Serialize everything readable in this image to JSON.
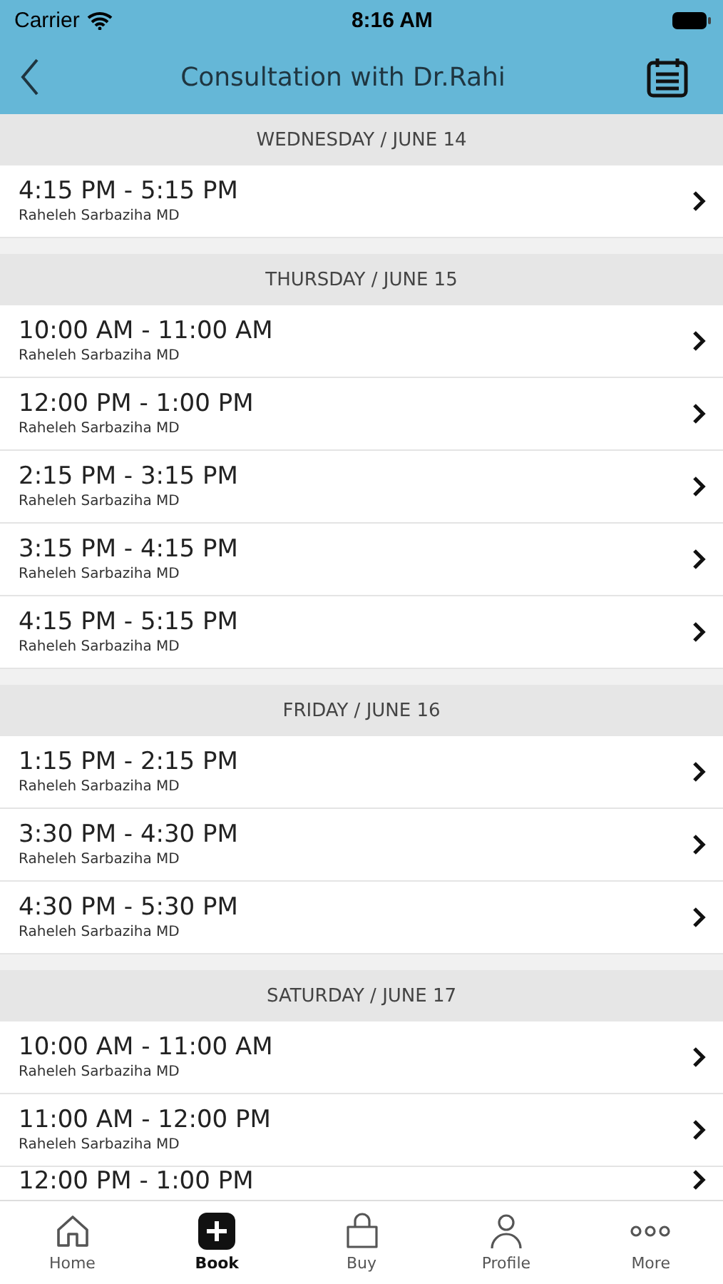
{
  "status_bar": {
    "carrier": "Carrier",
    "time": "8:16 AM"
  },
  "nav_bar": {
    "title": "Consultation with Dr.Rahi"
  },
  "days": [
    {
      "header": "WEDNESDAY / JUNE 14",
      "slots": [
        {
          "time": "4:15 PM - 5:15 PM",
          "doctor": "Raheleh Sarbaziha MD"
        }
      ]
    },
    {
      "header": "THURSDAY / JUNE 15",
      "slots": [
        {
          "time": "10:00 AM - 11:00 AM",
          "doctor": "Raheleh Sarbaziha MD"
        },
        {
          "time": "12:00 PM - 1:00 PM",
          "doctor": "Raheleh Sarbaziha MD"
        },
        {
          "time": "2:15 PM - 3:15 PM",
          "doctor": "Raheleh Sarbaziha MD"
        },
        {
          "time": "3:15 PM - 4:15 PM",
          "doctor": "Raheleh Sarbaziha MD"
        },
        {
          "time": "4:15 PM - 5:15 PM",
          "doctor": "Raheleh Sarbaziha MD"
        }
      ]
    },
    {
      "header": "FRIDAY / JUNE 16",
      "slots": [
        {
          "time": "1:15 PM - 2:15 PM",
          "doctor": "Raheleh Sarbaziha MD"
        },
        {
          "time": "3:30 PM - 4:30 PM",
          "doctor": "Raheleh Sarbaziha MD"
        },
        {
          "time": "4:30 PM - 5:30 PM",
          "doctor": "Raheleh Sarbaziha MD"
        }
      ]
    },
    {
      "header": "SATURDAY / JUNE 17",
      "slots": [
        {
          "time": "10:00 AM - 11:00 AM",
          "doctor": "Raheleh Sarbaziha MD"
        },
        {
          "time": "11:00 AM - 12:00 PM",
          "doctor": "Raheleh Sarbaziha MD"
        },
        {
          "time": "12:00 PM - 1:00 PM"
        }
      ]
    }
  ],
  "tab_bar": [
    {
      "label": "Home",
      "kind": "home",
      "selected": false
    },
    {
      "label": "Book",
      "kind": "book",
      "selected": true
    },
    {
      "label": "Buy",
      "kind": "buy",
      "selected": false
    },
    {
      "label": "Profile",
      "kind": "profile",
      "selected": false
    },
    {
      "label": "More",
      "kind": "more",
      "selected": false
    }
  ]
}
